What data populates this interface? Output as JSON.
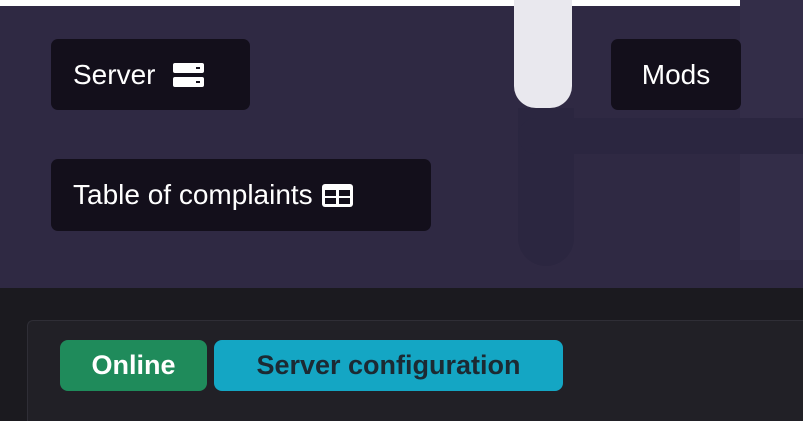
{
  "nav": {
    "server_label": "Server",
    "server_icon": "server-icon",
    "mods_label": "Mods",
    "complaints_label": "Table of complaints",
    "complaints_icon": "table-icon"
  },
  "status": {
    "online_label": "Online",
    "config_label": "Server configuration"
  },
  "colors": {
    "hero_background": "#2f2943",
    "button_background": "#130f1b",
    "online_badge": "#1f8b5b",
    "config_badge": "#14a6c4",
    "panel_background": "#212026"
  }
}
